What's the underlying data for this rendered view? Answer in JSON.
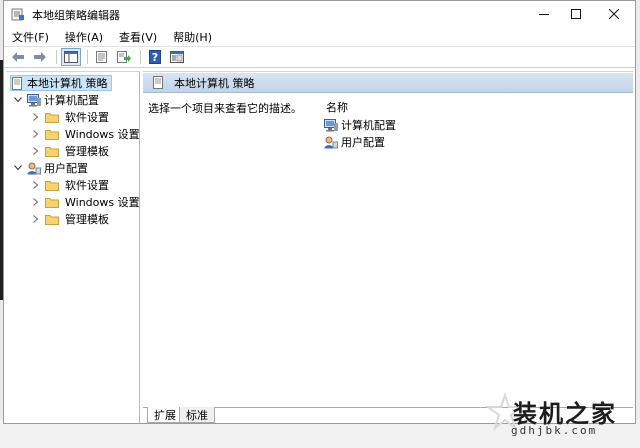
{
  "window": {
    "title": "本地组策略编辑器"
  },
  "menu": [
    "文件(F)",
    "操作(A)",
    "查看(V)",
    "帮助(H)"
  ],
  "toolbar": [
    "back-icon",
    "forward-icon",
    "show-hide-tree-icon",
    "properties-icon",
    "export-list-icon",
    "help-icon",
    "view-icon"
  ],
  "tree": {
    "root": "本地计算机 策略",
    "computer": {
      "label": "计算机配置",
      "children": [
        "软件设置",
        "Windows 设置",
        "管理模板"
      ]
    },
    "user": {
      "label": "用户配置",
      "children": [
        "软件设置",
        "Windows 设置",
        "管理模板"
      ]
    }
  },
  "pane": {
    "header": "本地计算机 策略",
    "description": "选择一个项目来查看它的描述。",
    "column_name": "名称",
    "items": [
      "计算机配置",
      "用户配置"
    ]
  },
  "tabs": [
    "扩展",
    "标准"
  ],
  "watermark": {
    "title": "装机之家",
    "url": "gdhjbk.com"
  },
  "colors": {
    "selection": "#cce4f7",
    "folder": "#f5d374",
    "header": "#c3d3e8"
  }
}
